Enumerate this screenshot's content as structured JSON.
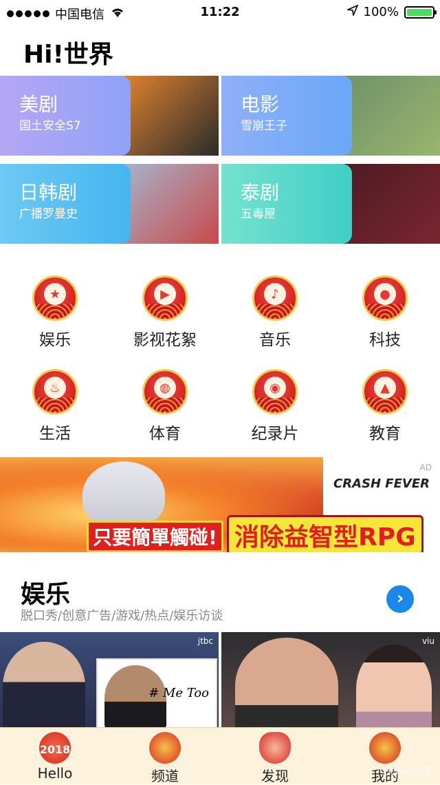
{
  "status": {
    "carrier": "中国电信",
    "time": "11:22",
    "battery": "100%"
  },
  "header": {
    "title": "Hi!世界"
  },
  "categories": [
    {
      "name": "美剧",
      "sub": "国土安全S7",
      "grad": [
        "#b6a5f5",
        "#8ea3f7"
      ],
      "photo": [
        "#f08a30",
        "#2b2b2b"
      ]
    },
    {
      "name": "电影",
      "sub": "雪崩王子",
      "grad": [
        "#8fb0f8",
        "#6aa8f7"
      ],
      "photo": [
        "#6b8f6a",
        "#9ab56d"
      ]
    },
    {
      "name": "日韩剧",
      "sub": "广播罗曼史",
      "grad": [
        "#6ec9f2",
        "#44b6f0"
      ],
      "photo": [
        "#a4bcd6",
        "#c84a4a"
      ]
    },
    {
      "name": "泰剧",
      "sub": "五毒屋",
      "grad": [
        "#76e2cf",
        "#3fcfc6"
      ],
      "photo": [
        "#4a1b22",
        "#7a2530"
      ]
    }
  ],
  "icons": [
    {
      "label": "娱乐",
      "symbol": "★",
      "name": "star-icon"
    },
    {
      "label": "影视花絮",
      "symbol": "▶",
      "name": "play-icon"
    },
    {
      "label": "音乐",
      "symbol": "♪",
      "name": "music-note-icon"
    },
    {
      "label": "科技",
      "symbol": "●",
      "name": "apple-icon"
    },
    {
      "label": "生活",
      "symbol": "♨",
      "name": "cup-icon"
    },
    {
      "label": "体育",
      "symbol": "◍",
      "name": "basketball-icon"
    },
    {
      "label": "纪录片",
      "symbol": "◉",
      "name": "camera-icon"
    },
    {
      "label": "教育",
      "symbol": "▲",
      "name": "graduation-cap-icon"
    }
  ],
  "ad": {
    "tag": "AD",
    "logo": "CRASH FEVER",
    "slogan1": "只要簡單觸碰!",
    "slogan2": "消除益智型RPG"
  },
  "section": {
    "title": "娱乐",
    "subtitle": "脱口秀/创意广告/游戏/热点/娱乐访谈",
    "more": "›"
  },
  "thumbs": [
    {
      "logo": "jtbc",
      "inset_text": "# Me Too"
    },
    {
      "logo": "viu"
    }
  ],
  "tabs": [
    {
      "label": "Hello",
      "badge": "2018"
    },
    {
      "label": "频道"
    },
    {
      "label": "发现"
    },
    {
      "label": "我的"
    }
  ],
  "watermark": "头条@问答"
}
